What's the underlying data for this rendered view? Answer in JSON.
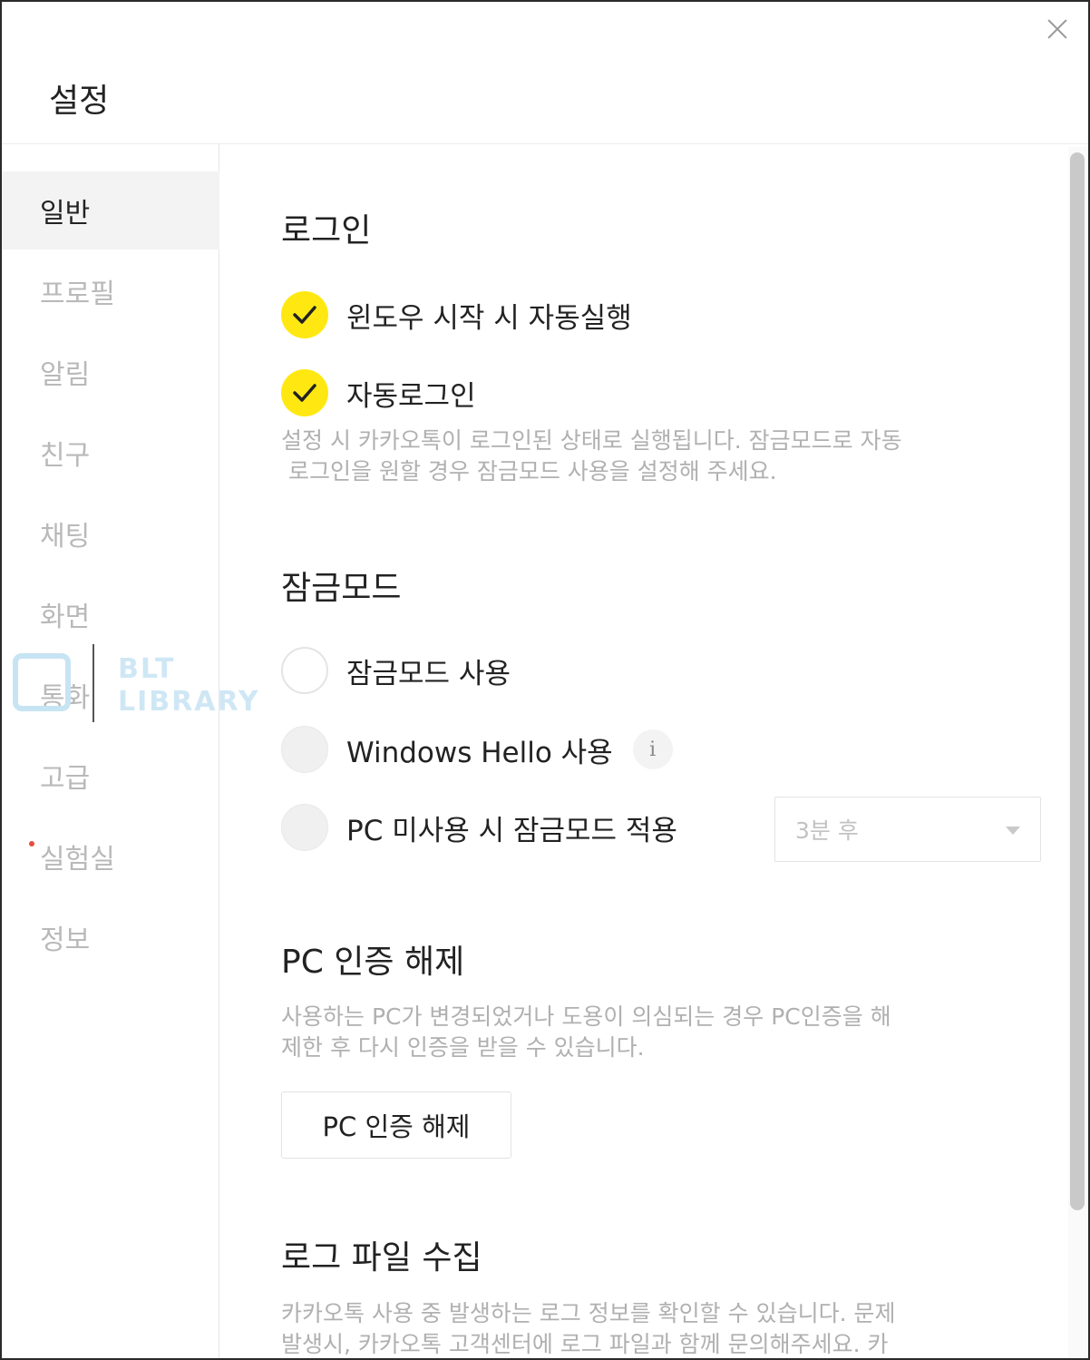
{
  "window": {
    "title": "설정"
  },
  "sidebar": {
    "items": [
      {
        "label": "일반",
        "active": true
      },
      {
        "label": "프로필"
      },
      {
        "label": "알림"
      },
      {
        "label": "친구"
      },
      {
        "label": "채팅"
      },
      {
        "label": "화면"
      },
      {
        "label": "통화"
      },
      {
        "label": "고급"
      },
      {
        "label": "실험실",
        "badge_dot": true
      },
      {
        "label": "정보"
      }
    ]
  },
  "login": {
    "title": "로그인",
    "auto_start": {
      "label": "윈도우 시작 시 자동실행",
      "checked": true
    },
    "auto_login": {
      "label": "자동로그인",
      "checked": true
    },
    "desc_line1": "설정 시 카카오톡이 로그인된 상태로 실행됩니다. 잠금모드로 자동",
    "desc_line2": "로그인을 원할 경우 잠금모드 사용을 설정해 주세요."
  },
  "lock": {
    "title": "잠금모드",
    "use_lock": {
      "label": "잠금모드 사용",
      "checked": false
    },
    "windows_hello": {
      "label": "Windows Hello 사용",
      "checked": false,
      "info_icon": "i"
    },
    "idle_lock": {
      "label": "PC 미사용 시 잠금모드 적용",
      "checked": false
    },
    "idle_select": {
      "value": "3분 후"
    }
  },
  "pc_auth": {
    "title": "PC 인증 해제",
    "desc_line1": "사용하는 PC가 변경되었거나 도용이 의심되는 경우 PC인증을 해",
    "desc_line2": "제한 후 다시 인증을 받을 수 있습니다.",
    "button_label": "PC 인증 해제"
  },
  "log": {
    "title": "로그 파일 수집",
    "desc_line1": "카카오톡 사용 중 발생하는 로그 정보를 확인할 수 있습니다. 문제",
    "desc_line2": "발생시, 카카오톡 고객센터에 로그 파일과 함께 문의해주세요. 카"
  },
  "watermark": {
    "line1": "BLT",
    "line2": "LIBRARY"
  },
  "colors": {
    "accent_yellow": "#ffe812",
    "nav_active_bg": "#f3f3f3",
    "muted_text": "#b0b0b0",
    "lab_dot": "#e74c3c"
  }
}
